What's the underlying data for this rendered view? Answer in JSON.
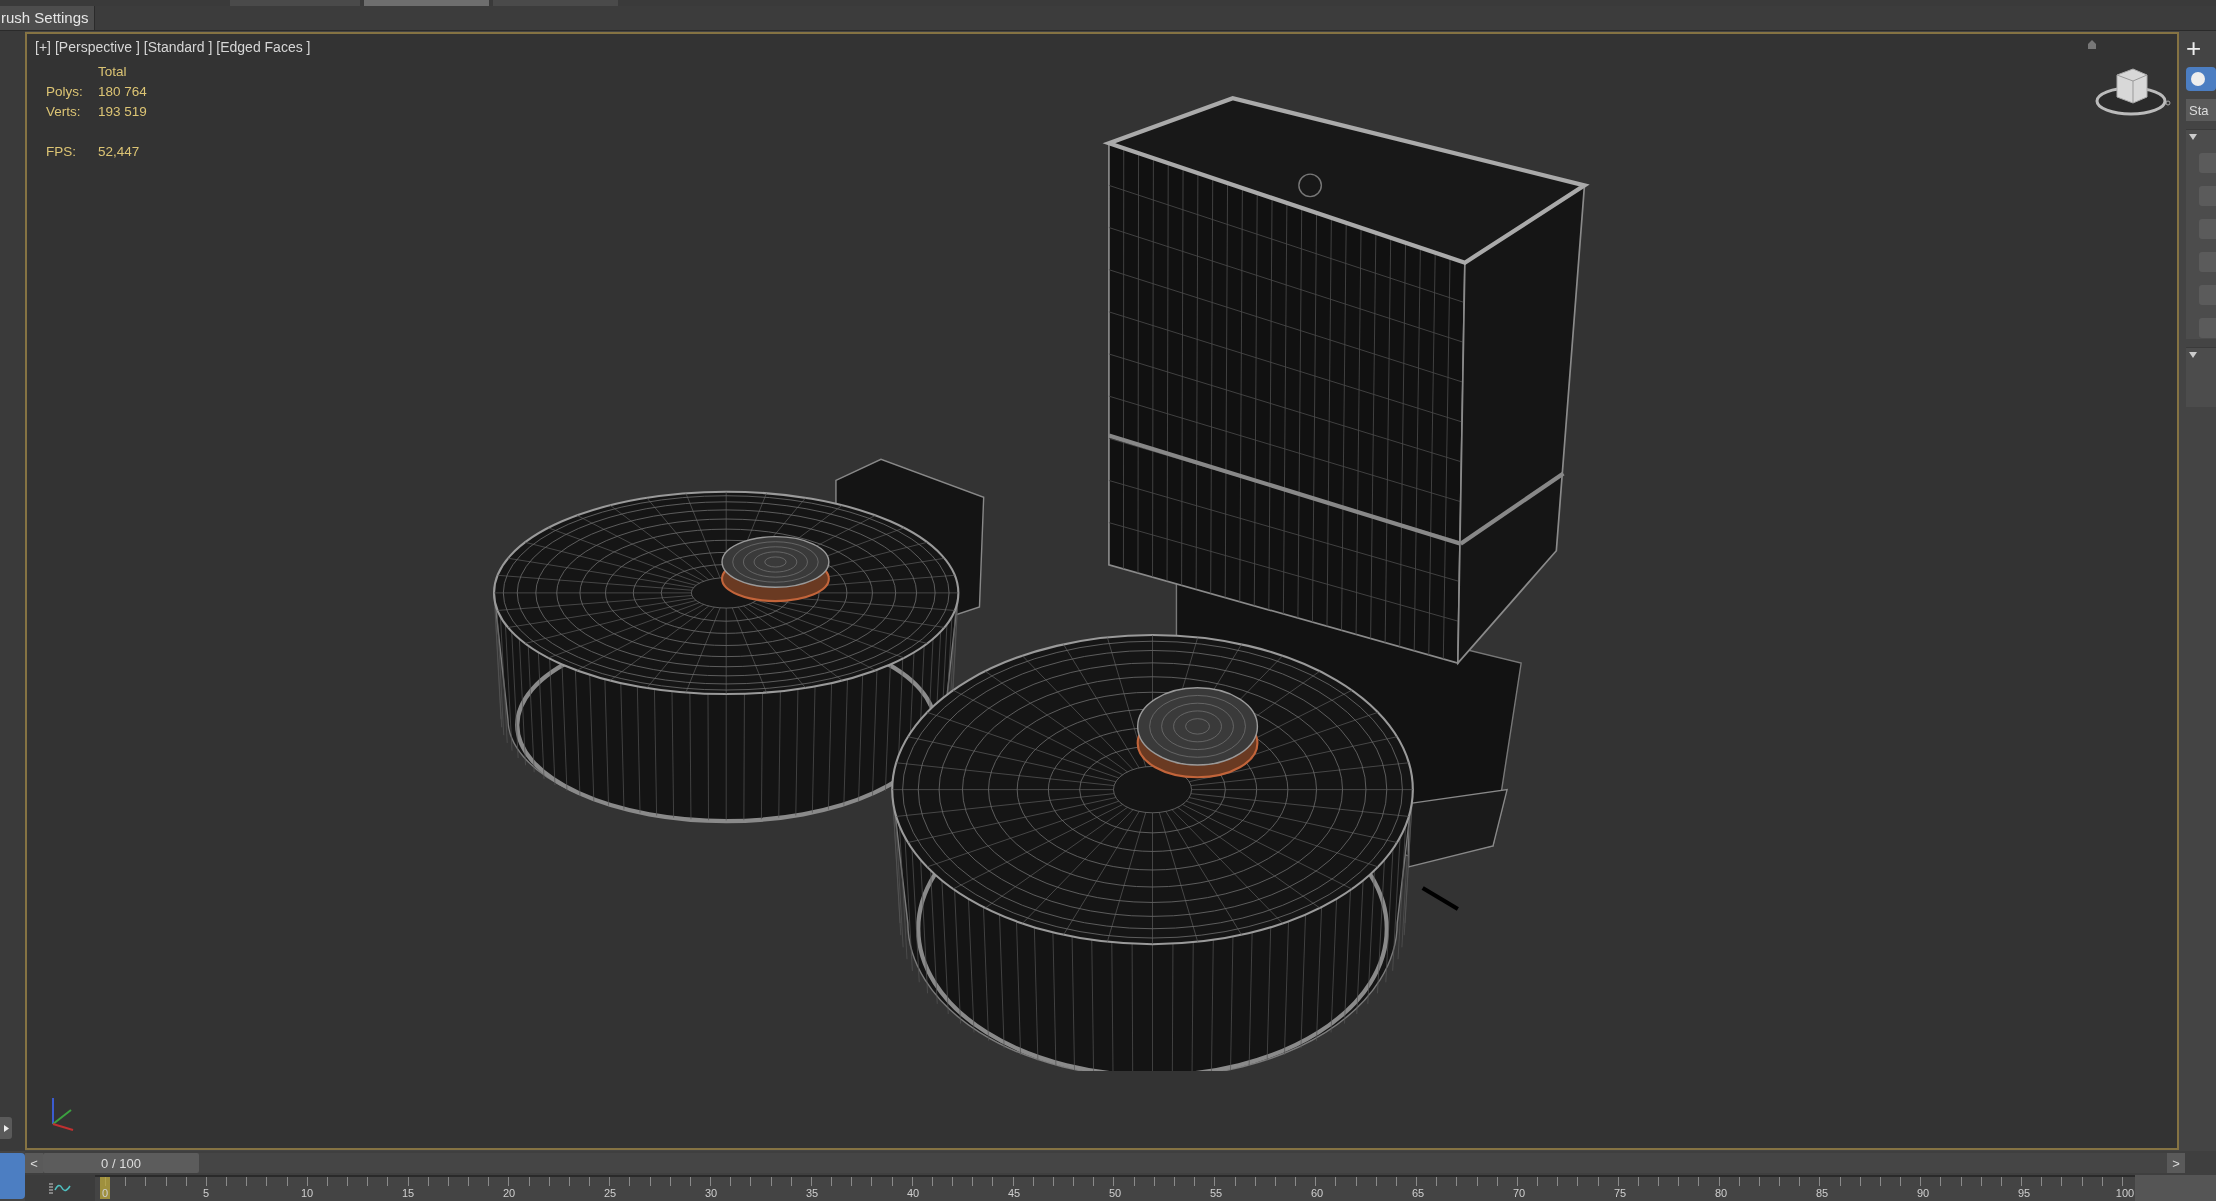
{
  "top_tabs": [
    {
      "selected": false
    },
    {
      "selected": true
    },
    {
      "selected": false
    }
  ],
  "panel_tab": {
    "label": "rush Settings"
  },
  "viewport": {
    "menus": [
      "[+]",
      "[Perspective ]",
      "[Standard ]",
      "[Edged Faces ]"
    ],
    "stats": {
      "header": "Total",
      "rows": [
        {
          "label": "Polys:",
          "value": "180 764"
        },
        {
          "label": "Verts:",
          "value": "193 519"
        }
      ],
      "fps": {
        "label": "FPS:",
        "value": "52,447"
      }
    }
  },
  "command_panel": {
    "add": "+",
    "dropdown": "Sta"
  },
  "time_slider": {
    "prev": "<",
    "position": "0 / 100",
    "next": ">",
    "level": 0
  },
  "timeline": {
    "ticks": [
      "0",
      "5",
      "10",
      "15",
      "20",
      "25",
      "30",
      "35",
      "40",
      "45",
      "50",
      "55",
      "60",
      "65",
      "70",
      "75",
      "80",
      "85",
      "90",
      "95",
      "100"
    ]
  }
}
